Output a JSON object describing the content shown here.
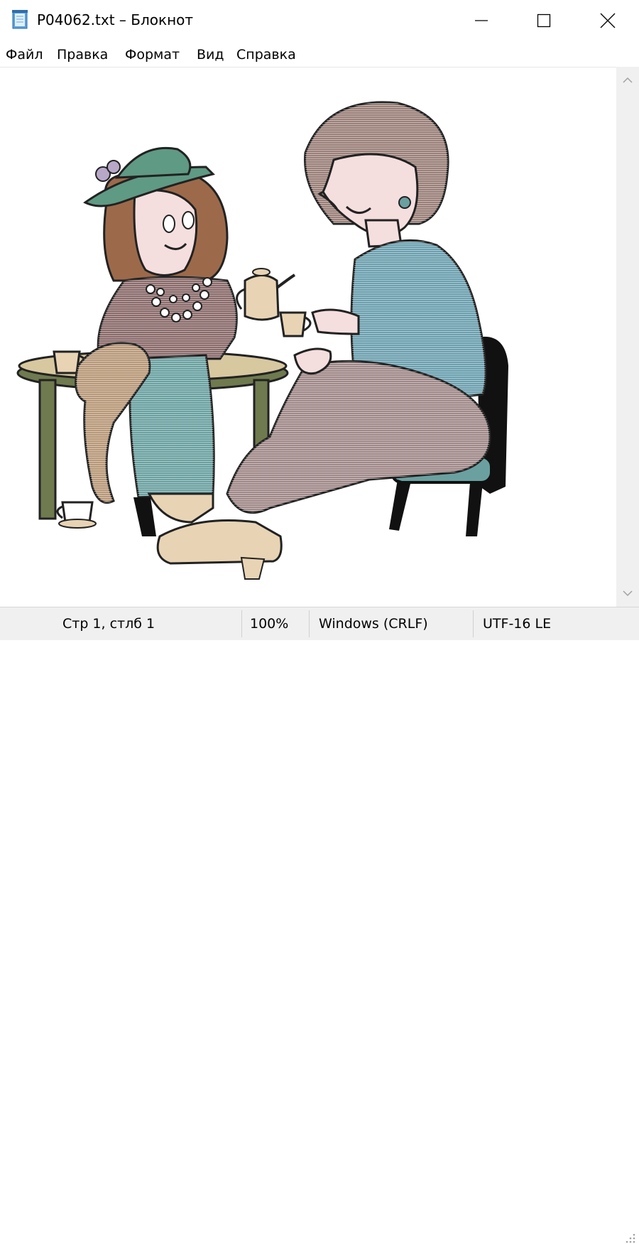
{
  "window": {
    "title": "P04062.txt – Блокнот",
    "icon": "notepad-icon"
  },
  "menu": {
    "items": [
      {
        "label": "Файл"
      },
      {
        "label": "Правка"
      },
      {
        "label": "Формат"
      },
      {
        "label": "Вид"
      },
      {
        "label": "Справка"
      }
    ]
  },
  "status": {
    "position": "Стр 1, стлб 1",
    "zoom": "100%",
    "line_endings": "Windows (CRLF)",
    "encoding": "UTF-16 LE"
  },
  "colors": {
    "hat": "#5f9a84",
    "skirt": "#6aa0a0",
    "blouse": "#6b9fae",
    "pants": "#a08888",
    "hair_girl": "#9c6a4a",
    "hair_woman": "#9a7f78",
    "skin": "#f5dede",
    "teacup": "#e8d4b4",
    "table": "#c8b890",
    "table_legs": "#6f7a4e",
    "teddy": "#b89878",
    "chair": "#111111"
  }
}
